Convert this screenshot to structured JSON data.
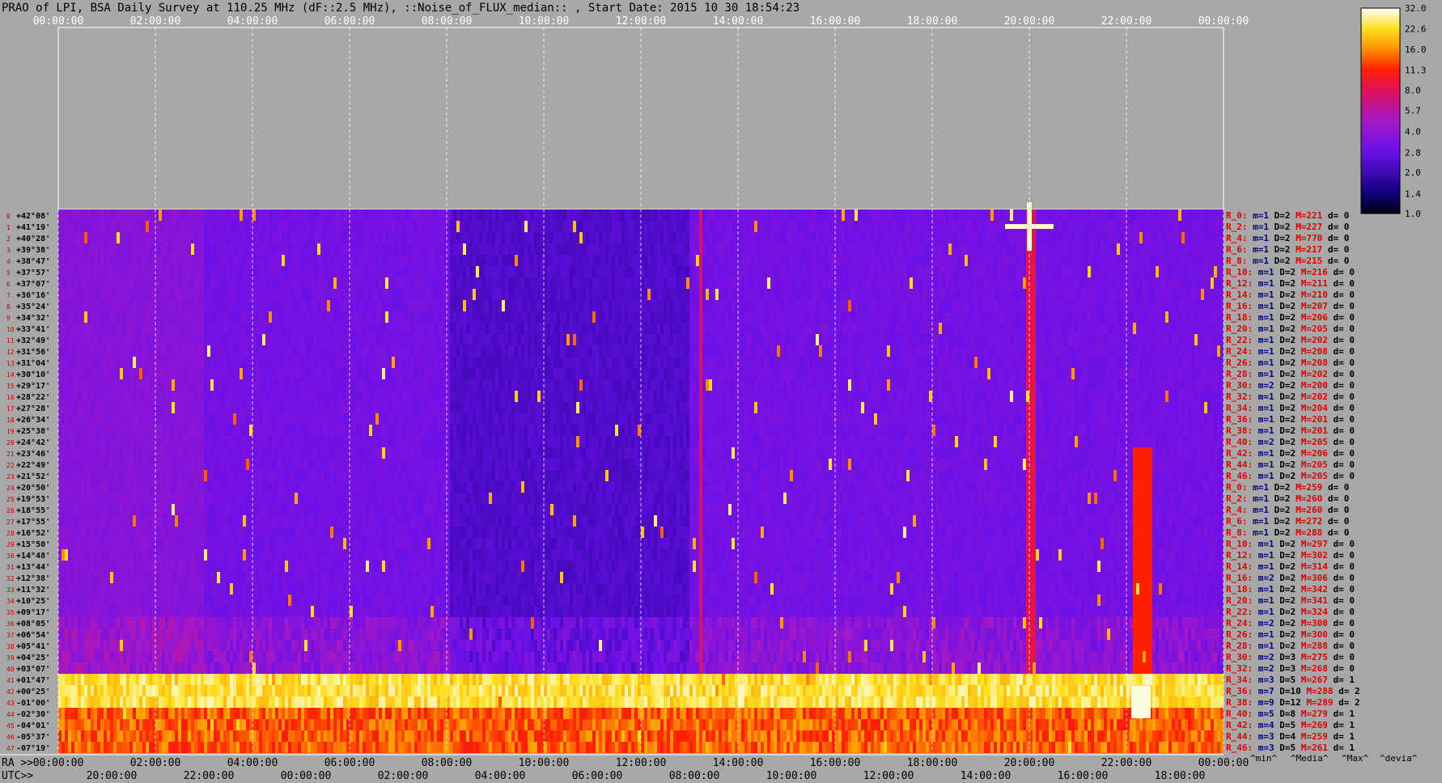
{
  "chart_data": {
    "type": "heatmap",
    "title": "PRAO of LPI, BSA Daily Survey at 110.25 MHz (dF::2.5 MHz), ::Noise_of_FLUX_median:: , Start Date: 2015 10 30 18:54:23",
    "top_time_ticks": [
      "00:00:00",
      "02:00:00",
      "04:00:00",
      "06:00:00",
      "08:00:00",
      "10:00:00",
      "12:00:00",
      "14:00:00",
      "16:00:00",
      "18:00:00",
      "20:00:00",
      "22:00:00",
      "00:00:00"
    ],
    "ra_label": "RA >>",
    "ra_ticks": [
      "00:00:00",
      "02:00:00",
      "04:00:00",
      "06:00:00",
      "08:00:00",
      "10:00:00",
      "12:00:00",
      "14:00:00",
      "16:00:00",
      "18:00:00",
      "20:00:00",
      "22:00:00",
      "00:00:00"
    ],
    "utc_label": "UTC>>",
    "utc_ticks": [
      "20:00:00",
      "22:00:00",
      "00:00:00",
      "02:00:00",
      "04:00:00",
      "06:00:00",
      "08:00:00",
      "10:00:00",
      "12:00:00",
      "14:00:00",
      "16:00:00",
      "18:00:00"
    ],
    "declinations": [
      "+42°08'",
      "+41°19'",
      "+40°28'",
      "+39°38'",
      "+38°47'",
      "+37°57'",
      "+37°07'",
      "+36°16'",
      "+35°24'",
      "+34°32'",
      "+33°41'",
      "+32°49'",
      "+31°56'",
      "+31°04'",
      "+30°10'",
      "+29°17'",
      "+28°22'",
      "+27°28'",
      "+26°34'",
      "+25°38'",
      "+24°42'",
      "+23°46'",
      "+22°49'",
      "+21°52'",
      "+20°50'",
      "+19°53'",
      "+18°55'",
      "+17°55'",
      "+16°52'",
      "+15°50'",
      "+14°48'",
      "+13°44'",
      "+12°38'",
      "+11°32'",
      "+10°25'",
      "+09°17'",
      "+08°05'",
      "+06°54'",
      "+05°41'",
      "+04°25'",
      "+03°07'",
      "+01°47'",
      "+00°25'",
      "-01°00'",
      "-02°30'",
      "-04°01'",
      "-05°37'",
      "-07°19'"
    ],
    "row_stats": [
      {
        "label": "R_0:",
        "m": "m=1",
        "D": "D=2",
        "M": "M=221",
        "d": "d= 0"
      },
      {
        "label": "R_2:",
        "m": "m=1",
        "D": "D=2",
        "M": "M=227",
        "d": "d= 0"
      },
      {
        "label": "R_4:",
        "m": "m=1",
        "D": "D=2",
        "M": "M=770",
        "d": "d= 0"
      },
      {
        "label": "R_6:",
        "m": "m=1",
        "D": "D=2",
        "M": "M=217",
        "d": "d= 0"
      },
      {
        "label": "R_8:",
        "m": "m=1",
        "D": "D=2",
        "M": "M=215",
        "d": "d= 0"
      },
      {
        "label": "R_10:",
        "m": "m=1",
        "D": "D=2",
        "M": "M=216",
        "d": "d= 0"
      },
      {
        "label": "R_12:",
        "m": "m=1",
        "D": "D=2",
        "M": "M=211",
        "d": "d= 0"
      },
      {
        "label": "R_14:",
        "m": "m=1",
        "D": "D=2",
        "M": "M=210",
        "d": "d= 0"
      },
      {
        "label": "R_16:",
        "m": "m=1",
        "D": "D=2",
        "M": "M=207",
        "d": "d= 0"
      },
      {
        "label": "R_18:",
        "m": "m=1",
        "D": "D=2",
        "M": "M=206",
        "d": "d= 0"
      },
      {
        "label": "R_20:",
        "m": "m=1",
        "D": "D=2",
        "M": "M=205",
        "d": "d= 0"
      },
      {
        "label": "R_22:",
        "m": "m=1",
        "D": "D=2",
        "M": "M=202",
        "d": "d= 0"
      },
      {
        "label": "R_24:",
        "m": "m=1",
        "D": "D=2",
        "M": "M=208",
        "d": "d= 0"
      },
      {
        "label": "R_26:",
        "m": "m=1",
        "D": "D=2",
        "M": "M=208",
        "d": "d= 0"
      },
      {
        "label": "R_28:",
        "m": "m=1",
        "D": "D=2",
        "M": "M=202",
        "d": "d= 0"
      },
      {
        "label": "R_30:",
        "m": "m=2",
        "D": "D=2",
        "M": "M=200",
        "d": "d= 0"
      },
      {
        "label": "R_32:",
        "m": "m=1",
        "D": "D=2",
        "M": "M=202",
        "d": "d= 0"
      },
      {
        "label": "R_34:",
        "m": "m=1",
        "D": "D=2",
        "M": "M=204",
        "d": "d= 0"
      },
      {
        "label": "R_36:",
        "m": "m=1",
        "D": "D=2",
        "M": "M=201",
        "d": "d= 0"
      },
      {
        "label": "R_38:",
        "m": "m=1",
        "D": "D=2",
        "M": "M=201",
        "d": "d= 0"
      },
      {
        "label": "R_40:",
        "m": "m=2",
        "D": "D=2",
        "M": "M=205",
        "d": "d= 0"
      },
      {
        "label": "R_42:",
        "m": "m=1",
        "D": "D=2",
        "M": "M=206",
        "d": "d= 0"
      },
      {
        "label": "R_44:",
        "m": "m=1",
        "D": "D=2",
        "M": "M=205",
        "d": "d= 0"
      },
      {
        "label": "R_46:",
        "m": "m=1",
        "D": "D=2",
        "M": "M=205",
        "d": "d= 0"
      },
      {
        "label": "R_0:",
        "m": "m=1",
        "D": "D=2",
        "M": "M=259",
        "d": "d= 0"
      },
      {
        "label": "R_2:",
        "m": "m=1",
        "D": "D=2",
        "M": "M=260",
        "d": "d= 0"
      },
      {
        "label": "R_4:",
        "m": "m=1",
        "D": "D=2",
        "M": "M=260",
        "d": "d= 0"
      },
      {
        "label": "R_6:",
        "m": "m=1",
        "D": "D=2",
        "M": "M=272",
        "d": "d= 0"
      },
      {
        "label": "R_8:",
        "m": "m=1",
        "D": "D=2",
        "M": "M=288",
        "d": "d= 0"
      },
      {
        "label": "R_10:",
        "m": "m=1",
        "D": "D=2",
        "M": "M=297",
        "d": "d= 0"
      },
      {
        "label": "R_12:",
        "m": "m=1",
        "D": "D=2",
        "M": "M=302",
        "d": "d= 0"
      },
      {
        "label": "R_14:",
        "m": "m=1",
        "D": "D=2",
        "M": "M=314",
        "d": "d= 0"
      },
      {
        "label": "R_16:",
        "m": "m=2",
        "D": "D=2",
        "M": "M=306",
        "d": "d= 0"
      },
      {
        "label": "R_18:",
        "m": "m=1",
        "D": "D=2",
        "M": "M=342",
        "d": "d= 0"
      },
      {
        "label": "R_20:",
        "m": "m=1",
        "D": "D=2",
        "M": "M=341",
        "d": "d= 0"
      },
      {
        "label": "R_22:",
        "m": "m=1",
        "D": "D=2",
        "M": "M=324",
        "d": "d= 0"
      },
      {
        "label": "R_24:",
        "m": "m=2",
        "D": "D=2",
        "M": "M=300",
        "d": "d= 0"
      },
      {
        "label": "R_26:",
        "m": "m=1",
        "D": "D=2",
        "M": "M=300",
        "d": "d= 0"
      },
      {
        "label": "R_28:",
        "m": "m=1",
        "D": "D=2",
        "M": "M=288",
        "d": "d= 0"
      },
      {
        "label": "R_30:",
        "m": "m=2",
        "D": "D=3",
        "M": "M=275",
        "d": "d= 0"
      },
      {
        "label": "R_32:",
        "m": "m=2",
        "D": "D=3",
        "M": "M=268",
        "d": "d= 0"
      },
      {
        "label": "R_34:",
        "m": "m=3",
        "D": "D=5",
        "M": "M=267",
        "d": "d= 1"
      },
      {
        "label": "R_36:",
        "m": "m=7",
        "D": "D=10",
        "M": "M=288",
        "d": "d= 2"
      },
      {
        "label": "R_38:",
        "m": "m=9",
        "D": "D=12",
        "M": "M=289",
        "d": "d= 2"
      },
      {
        "label": "R_40:",
        "m": "m=5",
        "D": "D=8",
        "M": "M=279",
        "d": "d= 1"
      },
      {
        "label": "R_42:",
        "m": "m=4",
        "D": "D=5",
        "M": "M=269",
        "d": "d= 1"
      },
      {
        "label": "R_44:",
        "m": "m=3",
        "D": "D=4",
        "M": "M=259",
        "d": "d= 1"
      },
      {
        "label": "R_46:",
        "m": "m=3",
        "D": "D=5",
        "M": "M=261",
        "d": "d= 1"
      }
    ],
    "stats_legend": {
      "min": "^min^",
      "median": "^Media^",
      "max": "^Max^",
      "dev": "^devia^"
    },
    "colorbar_ticks": [
      "32.0",
      "22.6",
      "16.0",
      "11.3",
      "8.0",
      "5.7",
      "4.0",
      "2.8",
      "2.0",
      "1.4",
      "1.0"
    ],
    "colorbar_range": [
      1.0,
      32.0
    ],
    "color_scale": "log",
    "colors": {
      "background": "#a8a8a8",
      "stat_min": "#000080",
      "stat_max": "#e00000",
      "stat_label": "#e00000"
    },
    "bright_features": [
      {
        "ra_h": 20.0,
        "row": 1,
        "kind": "cross"
      },
      {
        "ra_h": 22.3,
        "row": 43,
        "kind": "spot"
      }
    ]
  }
}
